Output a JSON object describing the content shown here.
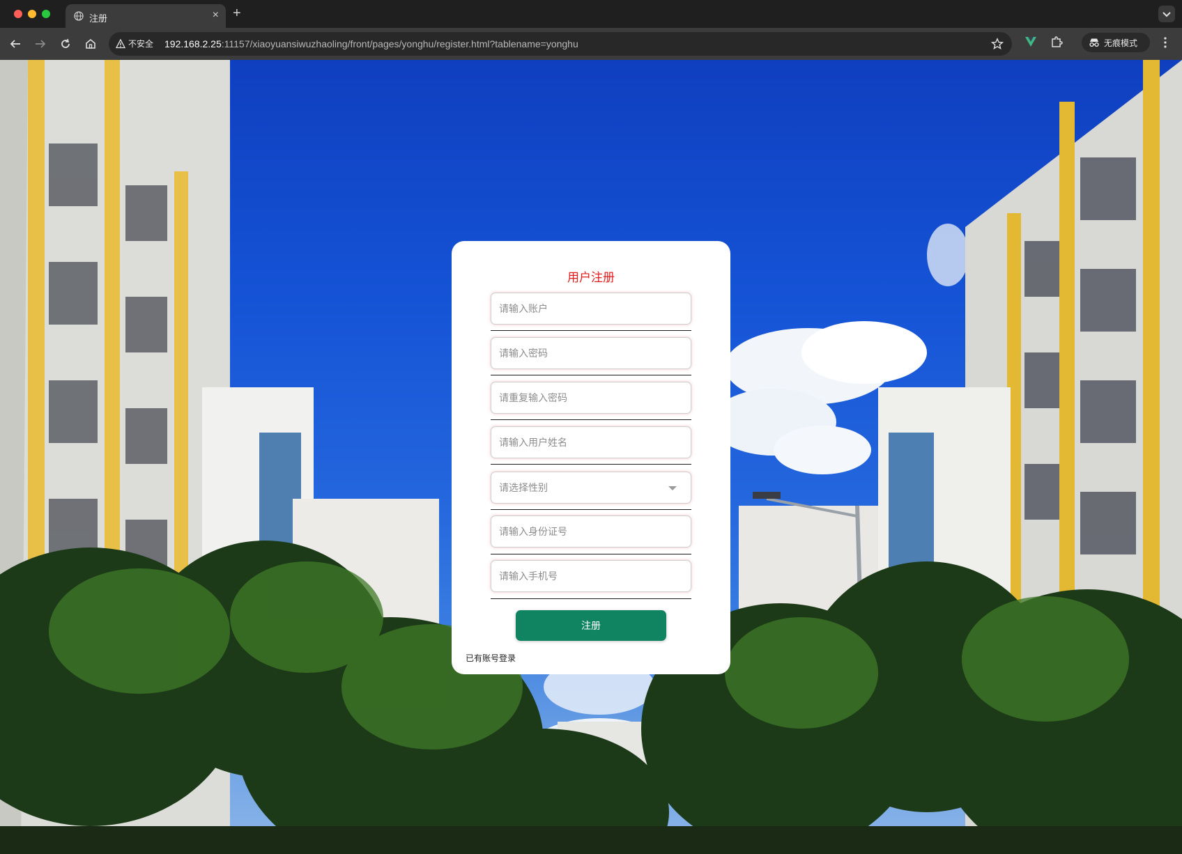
{
  "browser": {
    "tab_title": "注册",
    "new_tab": "+",
    "close_tab": "×",
    "security_label": "不安全",
    "url_host": "192.168.2.25",
    "url_rest": ":11157/xiaoyuansiwuzhaoling/front/pages/yonghu/register.html?tablename=yonghu",
    "incognito_label": "无痕模式"
  },
  "form": {
    "title": "用户注册",
    "fields": [
      {
        "placeholder": "请输入账户"
      },
      {
        "placeholder": "请输入密码"
      },
      {
        "placeholder": "请重复输入密码"
      },
      {
        "placeholder": "请输入用户姓名"
      },
      {
        "placeholder": "请选择性别",
        "type": "select"
      },
      {
        "placeholder": "请输入身份证号"
      },
      {
        "placeholder": "请输入手机号"
      }
    ],
    "submit_label": "注册",
    "login_link": "已有账号登录"
  },
  "colors": {
    "title": "#e31b1b",
    "submit": "#108460"
  }
}
